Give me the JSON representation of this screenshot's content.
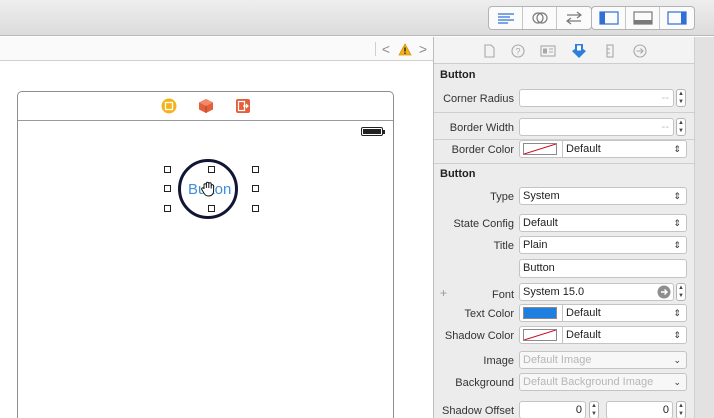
{
  "toolbar": {
    "editor_icons": [
      "standard-editor-icon",
      "assistant-editor-icon",
      "version-editor-icon"
    ],
    "view_icons": [
      "navigator-panel-icon",
      "debug-area-icon",
      "utilities-panel-icon"
    ]
  },
  "jumpbar": {
    "back": "<",
    "forward": ">",
    "warning_icon": "warning-triangle-icon"
  },
  "scene": {
    "dock_icons": [
      "view-controller-icon",
      "first-responder-icon",
      "exit-icon"
    ],
    "button_text": "Button"
  },
  "inspector": {
    "tab_icons": [
      "file-inspector-icon",
      "quick-help-icon",
      "identity-inspector-icon",
      "attributes-inspector-icon",
      "size-inspector-icon",
      "connections-inspector-icon"
    ],
    "section1": {
      "title": "Button",
      "corner_radius_label": "Corner Radius",
      "corner_radius_value": "--",
      "border_width_label": "Border Width",
      "border_width_value": "--",
      "border_color_label": "Border Color",
      "border_color_value": "Default"
    },
    "section2": {
      "title": "Button",
      "type_label": "Type",
      "type_value": "System",
      "state_config_label": "State Config",
      "state_config_value": "Default",
      "title_label": "Title",
      "title_value": "Plain",
      "title_text_value": "Button",
      "font_label": "Font",
      "font_value": "System 15.0",
      "text_color_label": "Text Color",
      "text_color_value": "Default",
      "text_color_swatch": "#1e7fe0",
      "shadow_color_label": "Shadow Color",
      "shadow_color_value": "Default",
      "image_label": "Image",
      "image_placeholder": "Default Image",
      "background_label": "Background",
      "background_placeholder": "Default Background Image",
      "shadow_offset_label": "Shadow Offset",
      "shadow_offset_x": "0",
      "shadow_offset_y": "0"
    }
  },
  "colors": {
    "accent_blue": "#3d8fd6",
    "selected_tab": "#2f7fd9",
    "warning": "#f2b01e"
  }
}
